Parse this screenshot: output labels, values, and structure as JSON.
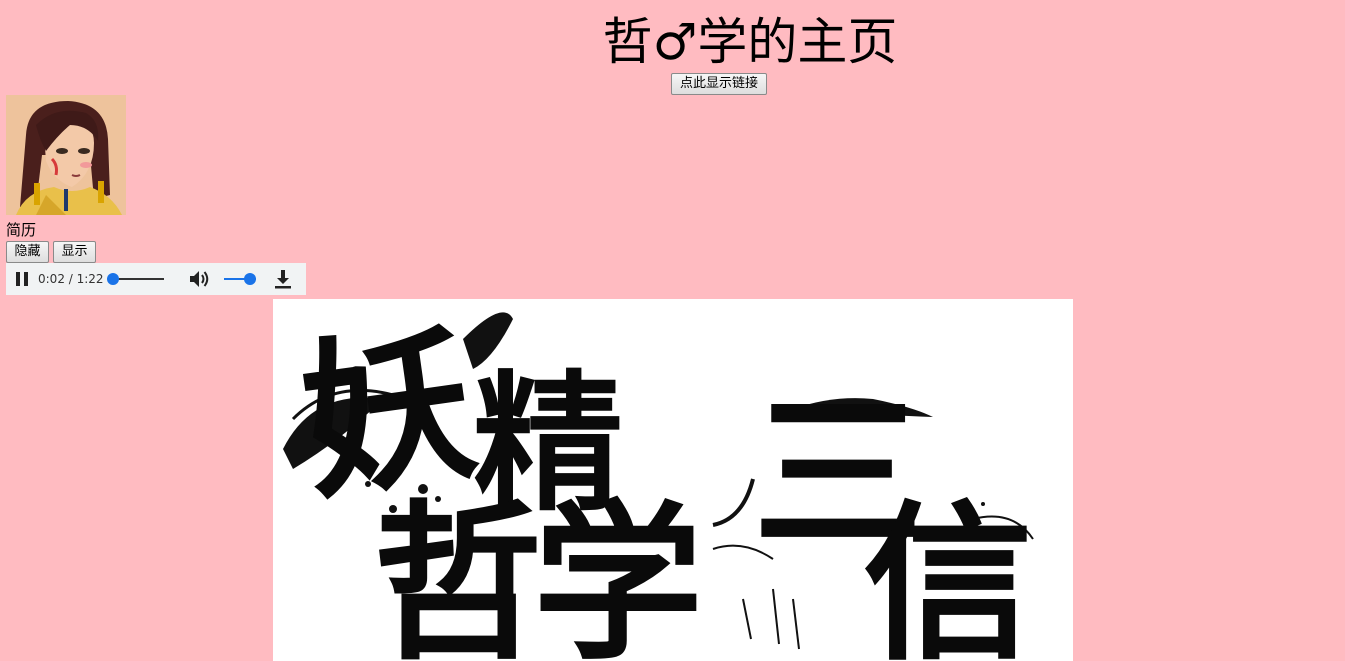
{
  "page": {
    "title": "哲♂学的主页",
    "show_links_button": "点此显示链接"
  },
  "profile": {
    "avatar_label": "avatar",
    "resume_label": "简历",
    "hide_button": "隐藏",
    "show_button": "显示"
  },
  "audio_player": {
    "time_display": "0:02 / 1:22",
    "progress_fraction": 0.025,
    "volume_fraction": 0.8,
    "state": "playing"
  },
  "banner": {
    "chars": [
      "妖",
      "精",
      "哲",
      "学",
      "三",
      "信"
    ]
  },
  "colors": {
    "background": "#ffbbc1",
    "accent": "#1a73e8",
    "player_bg": "#f1f3f4"
  }
}
